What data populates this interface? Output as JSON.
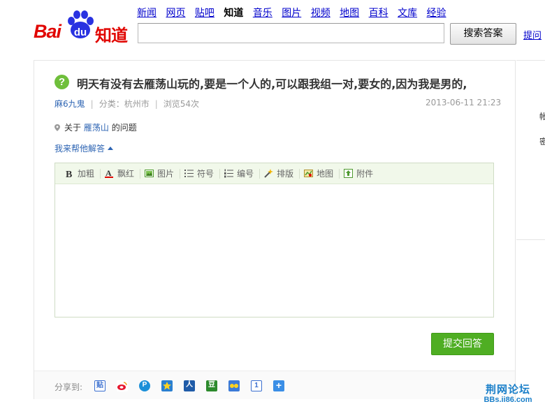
{
  "logo": {
    "left": "Bai",
    "paw_text": "du",
    "right": "知道"
  },
  "nav": {
    "items": [
      "新闻",
      "网页",
      "贴吧",
      "知道",
      "音乐",
      "图片",
      "视频",
      "地图",
      "百科",
      "文库",
      "经验"
    ],
    "current": "知道"
  },
  "search": {
    "value": "",
    "button_label": "搜索答案",
    "ask_link": "提问"
  },
  "question": {
    "title": "明天有没有去雁荡山玩的,要是一个人的,可以跟我组一对,要女的,因为我是男的,",
    "author": "麻6九鬼",
    "category": "分类：杭州市",
    "views": "浏览54次",
    "time": "2013-06-11 21:23",
    "about_prefix": "关于",
    "about_tag": "雁荡山",
    "about_suffix": "的问题"
  },
  "answer": {
    "toggle_label": "我来帮他解答",
    "toolbar": [
      {
        "label": "加粗",
        "icon": "bold-icon"
      },
      {
        "label": "飘红",
        "icon": "red-text-icon"
      },
      {
        "label": "图片",
        "icon": "image-icon"
      },
      {
        "label": "符号",
        "icon": "bullet-list-icon"
      },
      {
        "label": "编号",
        "icon": "numbered-list-icon"
      },
      {
        "label": "排版",
        "icon": "magic-wand-icon"
      },
      {
        "label": "地图",
        "icon": "map-icon"
      },
      {
        "label": "附件",
        "icon": "attachment-icon"
      }
    ],
    "body": "",
    "submit_label": "提交回答"
  },
  "share": {
    "label": "分享到:",
    "targets": [
      "tieba",
      "weibo",
      "qzone",
      "qq",
      "renren",
      "douban",
      "kaixin",
      "tsina",
      "more"
    ]
  },
  "side": {
    "chars": [
      "帐",
      "密"
    ]
  },
  "watermark": {
    "line1": "荆网论坛",
    "line2": "BBs.ii86.com"
  },
  "colors": {
    "accent_green": "#4fae23",
    "link_blue": "#2d64b3",
    "nav_blue": "#0000cc",
    "brand_red": "#e10602",
    "brand_blue": "#2932e1"
  }
}
